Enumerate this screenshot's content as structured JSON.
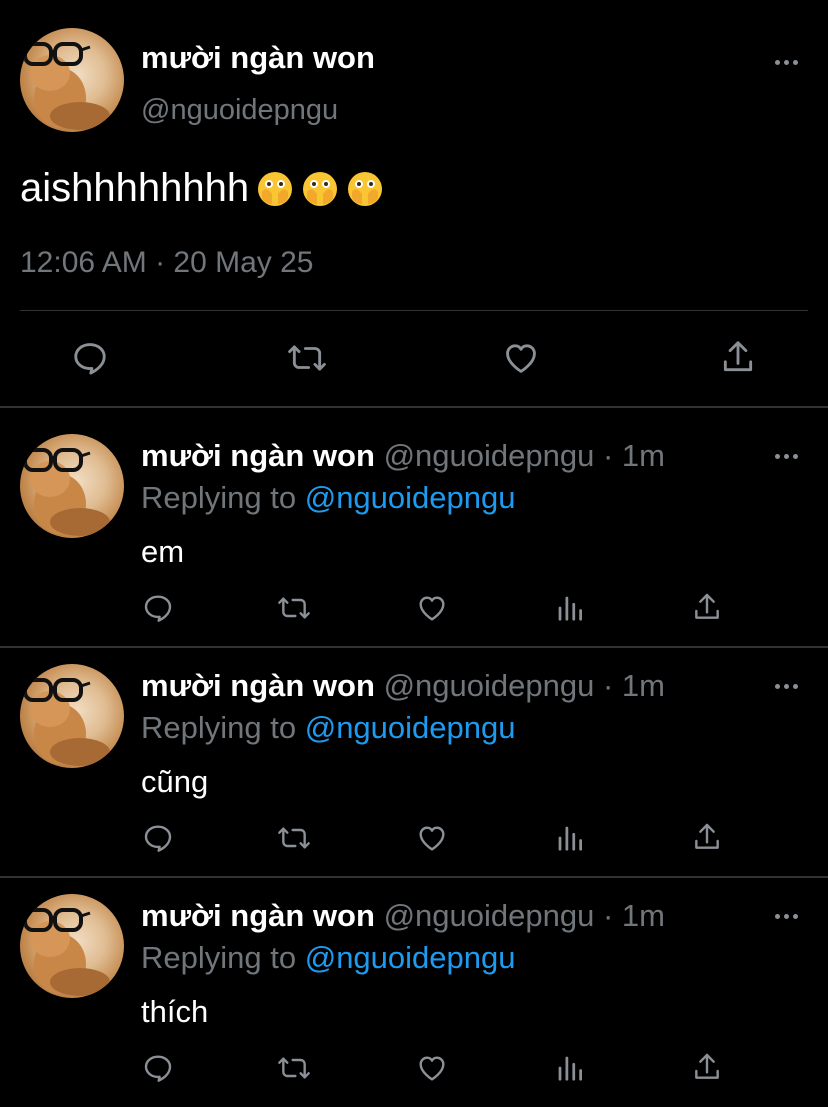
{
  "main_tweet": {
    "display_name": "mười ngàn won",
    "handle": "@nguoidepngu",
    "text": "aishhhhhhhh",
    "emojis": [
      "face-with-open-eyes-and-hand-over-mouth",
      "face-with-open-eyes-and-hand-over-mouth",
      "face-with-open-eyes-and-hand-over-mouth"
    ],
    "timestamp": "12:06 AM · 20 May 25",
    "actions": [
      "reply-icon",
      "retweet-icon",
      "like-icon",
      "share-icon"
    ]
  },
  "replies": [
    {
      "display_name": "mười ngàn won",
      "handle": "@nguoidepngu",
      "separator": "·",
      "time": "1m",
      "replying_prefix": "Replying to ",
      "replying_to": "@nguoidepngu",
      "text": "em"
    },
    {
      "display_name": "mười ngàn won",
      "handle": "@nguoidepngu",
      "separator": "·",
      "time": "1m",
      "replying_prefix": "Replying to ",
      "replying_to": "@nguoidepngu",
      "text": "cũng"
    },
    {
      "display_name": "mười ngàn won",
      "handle": "@nguoidepngu",
      "separator": "·",
      "time": "1m",
      "replying_prefix": "Replying to ",
      "replying_to": "@nguoidepngu",
      "text": "thích"
    }
  ],
  "reply_actions": [
    "reply-icon",
    "retweet-icon",
    "like-icon",
    "views-icon",
    "share-icon"
  ],
  "colors": {
    "background": "#000000",
    "text_primary": "#ffffff",
    "text_secondary": "#71767b",
    "accent": "#1d9bf0",
    "divider": "#2f3336"
  }
}
